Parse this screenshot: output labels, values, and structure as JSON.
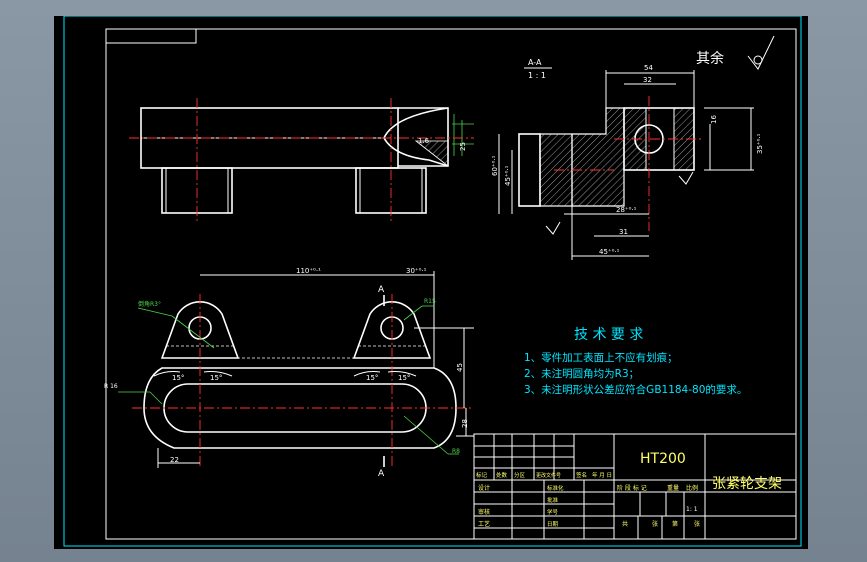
{
  "section_label": {
    "name": "A-A",
    "scale": "1 : 1"
  },
  "roughness_note": "其余",
  "dims": {
    "d54": "54",
    "d32": "32",
    "d16": "16",
    "d35": "35⁺⁰·¹",
    "d60": "60⁺⁰·¹",
    "d45v": "45⁺⁰·¹",
    "d28": "28⁺⁰·¹",
    "d31": "31",
    "d45h": "45⁺⁰·¹",
    "d110": "110⁺⁰·¹",
    "d30": "30⁺⁰·¹",
    "d22": "22",
    "d45r": "45",
    "d28r": "28",
    "ang15a": "15°",
    "ang15b": "15°",
    "ang15c": "15°",
    "ang15d": "15°",
    "r16": "R 16",
    "d16s": "1.6",
    "d25": "25"
  },
  "section_marks": {
    "top": "A",
    "bottom": "A"
  },
  "callouts": {
    "top_left": "倒角R3°",
    "top_right": "R15",
    "bottom_right": "R8"
  },
  "tech_req": {
    "title": "技 术 要 求",
    "items": [
      "1、零件加工表面上不应有划痕；",
      "2、未注明圆角均为R3；",
      "3、未注明形状公差应符合GB1184-80的要求。"
    ]
  },
  "title_block": {
    "material": "HT200",
    "part_name": "张紧轮支架",
    "row_labels": [
      "标记",
      "处数",
      "分区",
      "更改文件号",
      "签名",
      "年 月 日"
    ],
    "left_labels": [
      "设计",
      "审核",
      "工艺"
    ],
    "mid_labels": [
      "标准化",
      "批准",
      "学号",
      "日期"
    ],
    "stage_labels": [
      "阶 段 标 记",
      "重量",
      "比例"
    ],
    "scale_value": "1: 1",
    "sheet_labels": [
      "共",
      "张",
      "第",
      "张"
    ]
  }
}
